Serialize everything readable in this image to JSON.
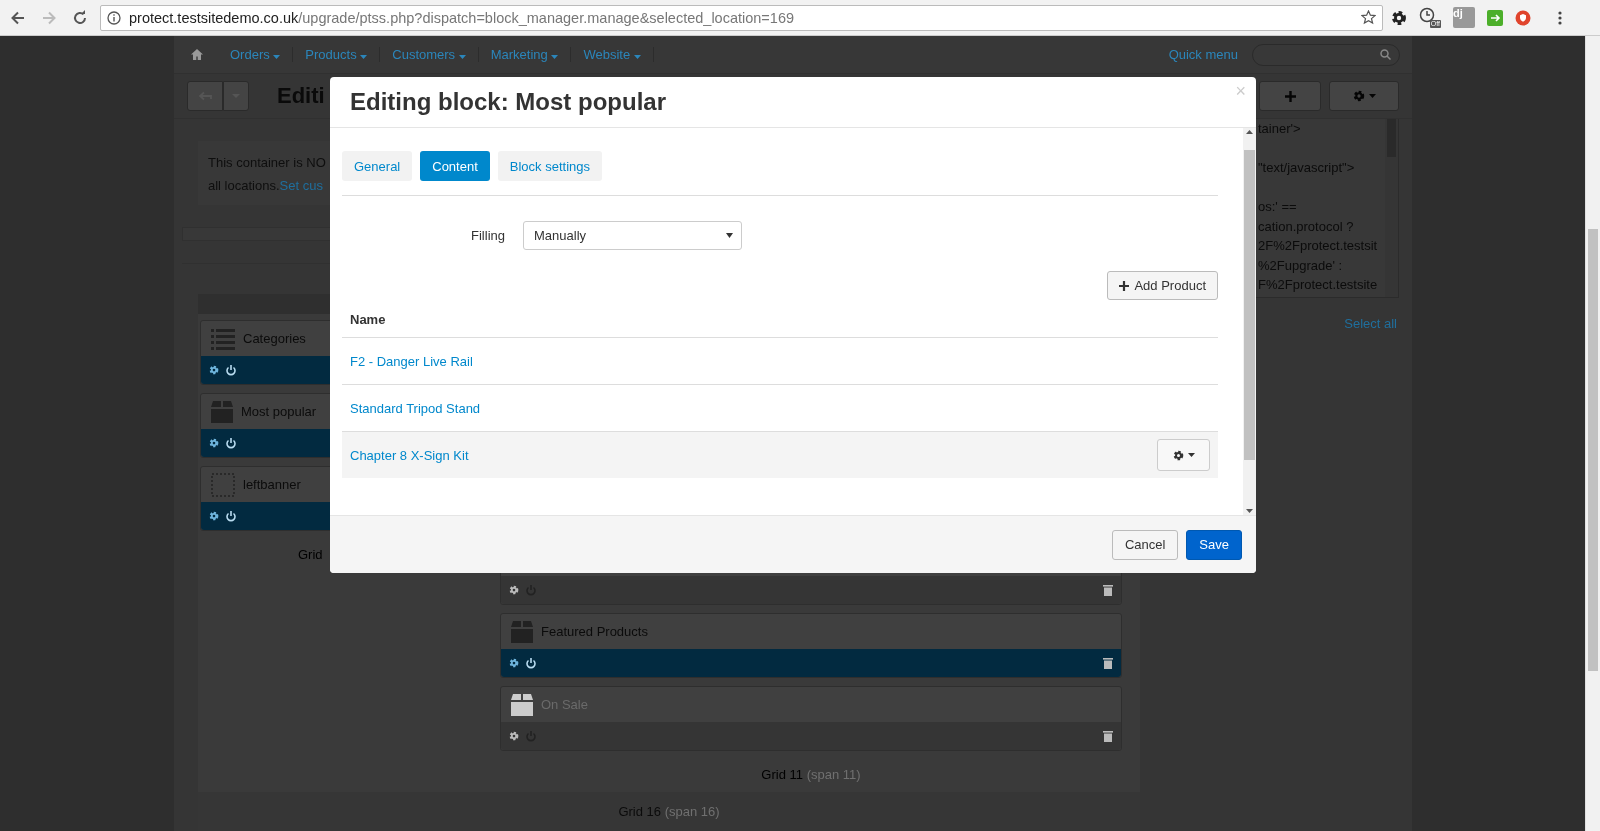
{
  "browser": {
    "url_host": "protect.testsitedemo.co.uk",
    "url_path": "/upgrade/ptss.php?dispatch=block_manager.manage&selected_location=169",
    "extensions": [
      {
        "kind": "gear"
      },
      {
        "kind": "clock",
        "badge": "Off"
      },
      {
        "kind": "dj",
        "label": "dj"
      },
      {
        "kind": "green"
      },
      {
        "kind": "red"
      }
    ]
  },
  "nav": {
    "menu": [
      {
        "label": "Orders"
      },
      {
        "label": "Products"
      },
      {
        "label": "Customers"
      },
      {
        "label": "Marketing"
      },
      {
        "label": "Website"
      }
    ],
    "quick_menu": "Quick menu"
  },
  "toolbar": {
    "title": "Editi"
  },
  "notice": {
    "line_1": "This container is NO",
    "line_2": "all locations.",
    "link": "Set cus"
  },
  "left_grid": {
    "label": "Grid",
    "blocks": [
      {
        "title": "Categories",
        "kind": "list",
        "enabled": true
      },
      {
        "title": "Most popular",
        "kind": "box",
        "enabled": true
      },
      {
        "title": "leftbanner",
        "kind": "banner",
        "enabled": true
      }
    ]
  },
  "center_grid": {
    "label": "Grid 11",
    "span": "(span 11)",
    "blocks": [
      {
        "kind": "banner",
        "enabled": false
      },
      {
        "title": "Featured Products",
        "kind": "box",
        "enabled": true
      },
      {
        "title": "On Sale",
        "kind": "box",
        "enabled": false
      }
    ]
  },
  "outer_grid": {
    "label": "Grid 16",
    "span": "(span 16)"
  },
  "code_panel": {
    "text": "tainer'>\n\n\"text/javascript\">\n\nos:' ==\ncation.protocol ?\n2F%2Fprotect.testsit\n%2Fupgrade' :\nF%2Fprotect.testsite",
    "select_all": "Select all"
  },
  "modal": {
    "title": "Editing block: Most popular",
    "close": "×",
    "tabs": [
      {
        "label": "General",
        "selected": false
      },
      {
        "label": "Content",
        "selected": true
      },
      {
        "label": "Block settings",
        "selected": false
      }
    ],
    "filling_label": "Filling",
    "filling_value": "Manually",
    "add_button": "Add Product",
    "column": "Name",
    "rows": [
      {
        "name": "F2 - Danger Live Rail",
        "hovered": false
      },
      {
        "name": "Standard Tripod Stand",
        "hovered": false
      },
      {
        "name": "Chapter 8 X-Sign Kit",
        "hovered": true
      }
    ],
    "cancel": "Cancel",
    "save": "Save"
  }
}
